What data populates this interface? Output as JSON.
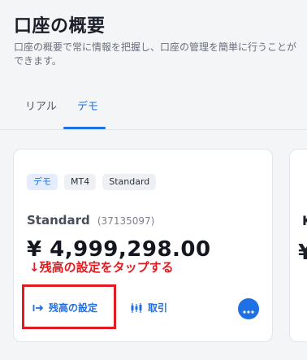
{
  "header": {
    "title": "口座の概要",
    "description": "口座の概要で常に情報を把握し、口座の管理を簡単に行うことができます。"
  },
  "tabs": [
    {
      "label": "リアル",
      "active": false
    },
    {
      "label": "デモ",
      "active": true
    }
  ],
  "account_card": {
    "badges": [
      "デモ",
      "MT4",
      "Standard"
    ],
    "account_type": "Standard",
    "account_number": "(37135097)",
    "balance": "¥ 4,999,298.00",
    "actions": {
      "set_balance": "残高の設定",
      "trade": "取引"
    }
  },
  "annotation": "↓残高の設定をタップする",
  "next_card": {
    "initial": "K"
  },
  "colors": {
    "accent": "#1f6fe5",
    "annotation": "#e11b22"
  }
}
